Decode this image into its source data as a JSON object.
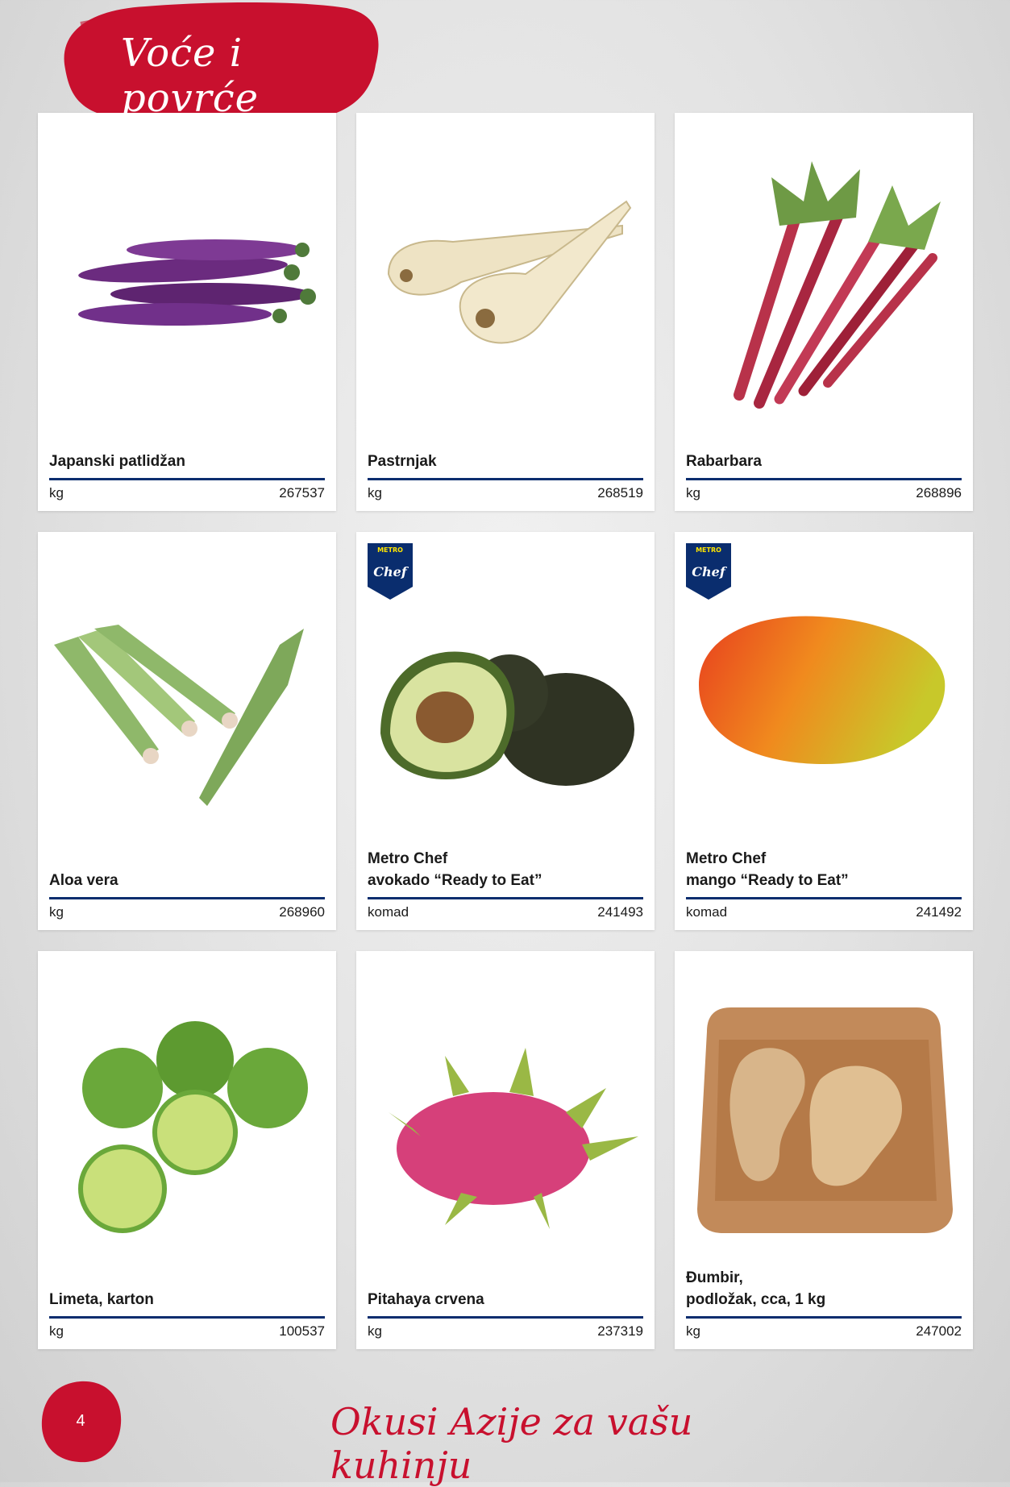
{
  "header": {
    "title": "Voće i povrće"
  },
  "colors": {
    "brand_red": "#c8102e",
    "metro_blue": "#0a2d6e",
    "metro_yellow": "#ffe500"
  },
  "products": [
    {
      "name": "Japanski patlidžan",
      "unit": "kg",
      "code": "267537",
      "icon": "eggplant-icon"
    },
    {
      "name": "Pastrnjak",
      "unit": "kg",
      "code": "268519",
      "icon": "parsnip-icon"
    },
    {
      "name": "Rabarbara",
      "unit": "kg",
      "code": "268896",
      "icon": "rhubarb-icon"
    },
    {
      "name": "Aloa vera",
      "unit": "kg",
      "code": "268960",
      "icon": "aloe-vera-icon"
    },
    {
      "name": "Metro Chef\navokado “Ready to Eat”",
      "unit": "komad",
      "code": "241493",
      "icon": "avocado-icon",
      "badge": {
        "top": "METRO",
        "bottom": "Chef"
      }
    },
    {
      "name": "Metro Chef\nmango “Ready to Eat”",
      "unit": "komad",
      "code": "241492",
      "icon": "mango-icon",
      "badge": {
        "top": "METRO",
        "bottom": "Chef"
      }
    },
    {
      "name": "Limeta, karton",
      "unit": "kg",
      "code": "100537",
      "icon": "lime-icon"
    },
    {
      "name": "Pitahaya crvena",
      "unit": "kg",
      "code": "237319",
      "icon": "dragon-fruit-icon"
    },
    {
      "name": "Đumbir,\npodložak, cca, 1 kg",
      "unit": "kg",
      "code": "247002",
      "icon": "ginger-tray-icon"
    }
  ],
  "footer": {
    "page_number": "4",
    "slogan": "Okusi Azije za vašu kuhinju"
  }
}
